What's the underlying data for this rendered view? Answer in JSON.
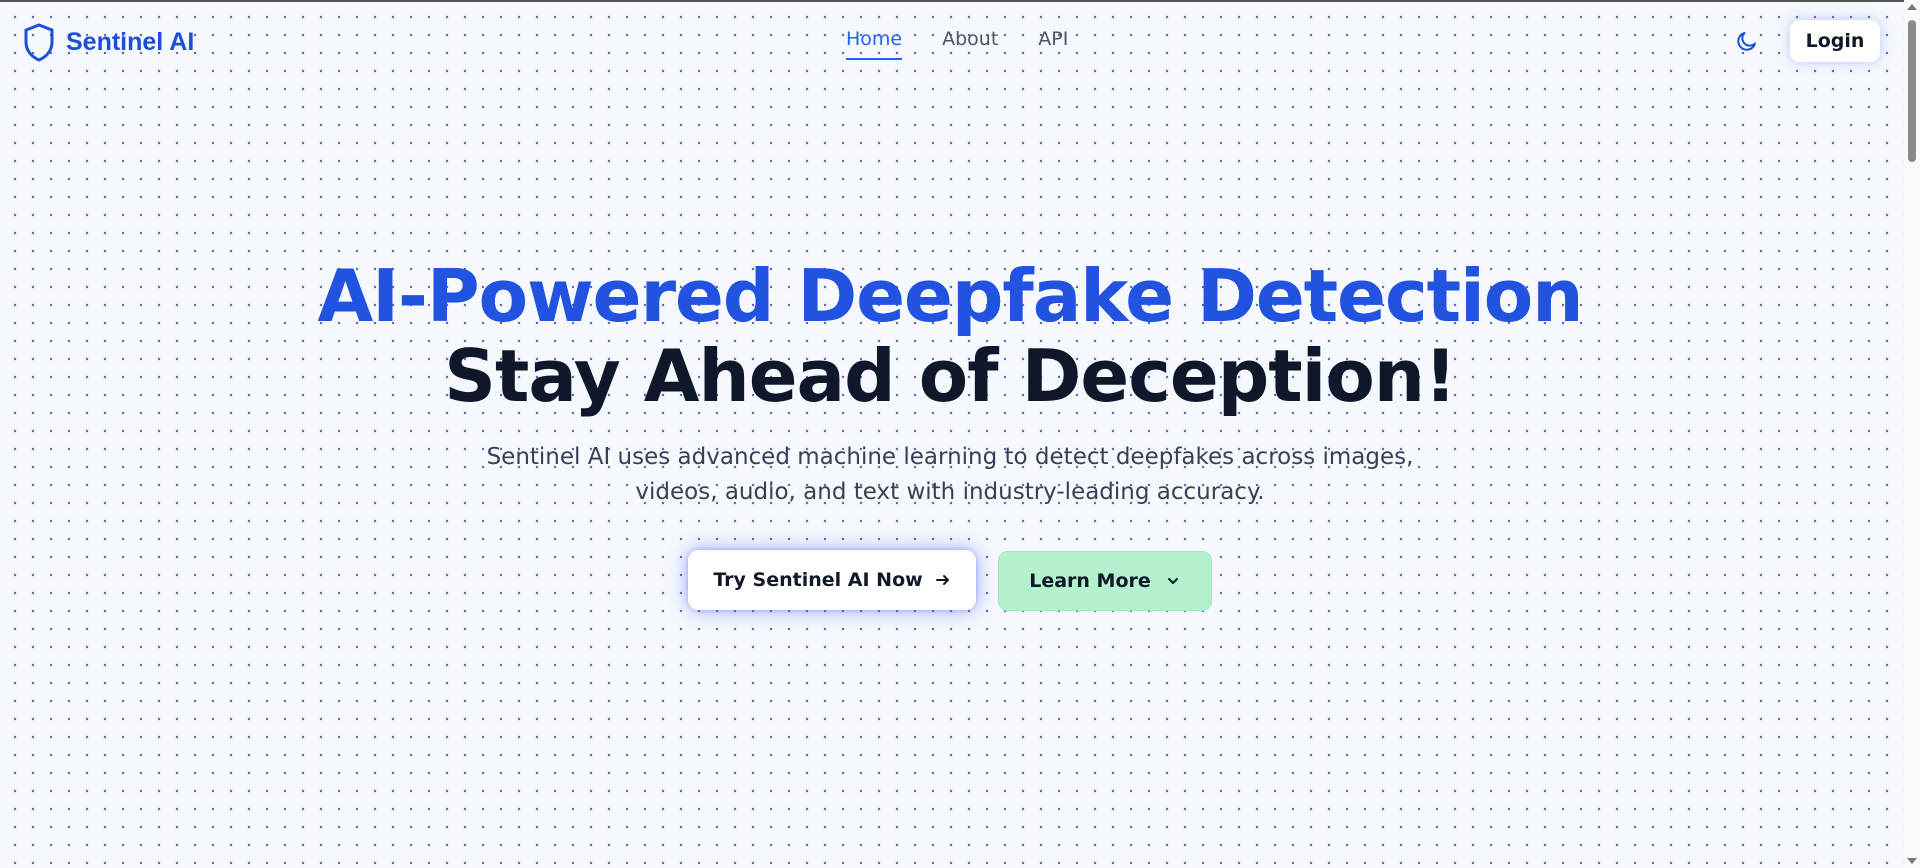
{
  "brand": {
    "name": "Sentinel AI",
    "icon": "shield-icon",
    "color": "#1d4ed8"
  },
  "nav": {
    "items": [
      {
        "label": "Home",
        "active": true
      },
      {
        "label": "About",
        "active": false
      },
      {
        "label": "API",
        "active": false
      }
    ],
    "active_color": "#2563eb"
  },
  "header": {
    "theme_toggle_icon": "moon-icon",
    "login_label": "Login"
  },
  "hero": {
    "title_line1": "AI-Powered Deepfake Detection",
    "title_line2": "Stay Ahead of Deception!",
    "subtitle": "Sentinel AI uses advanced machine learning to detect deepfakes across images, videos, audio, and text with industry-leading accuracy.",
    "primary_button": {
      "label": "Try Sentinel AI Now",
      "icon": "arrow-right-icon"
    },
    "secondary_button": {
      "label": "Learn More",
      "icon": "chevron-down-icon",
      "color": "#b4f2cf"
    }
  }
}
